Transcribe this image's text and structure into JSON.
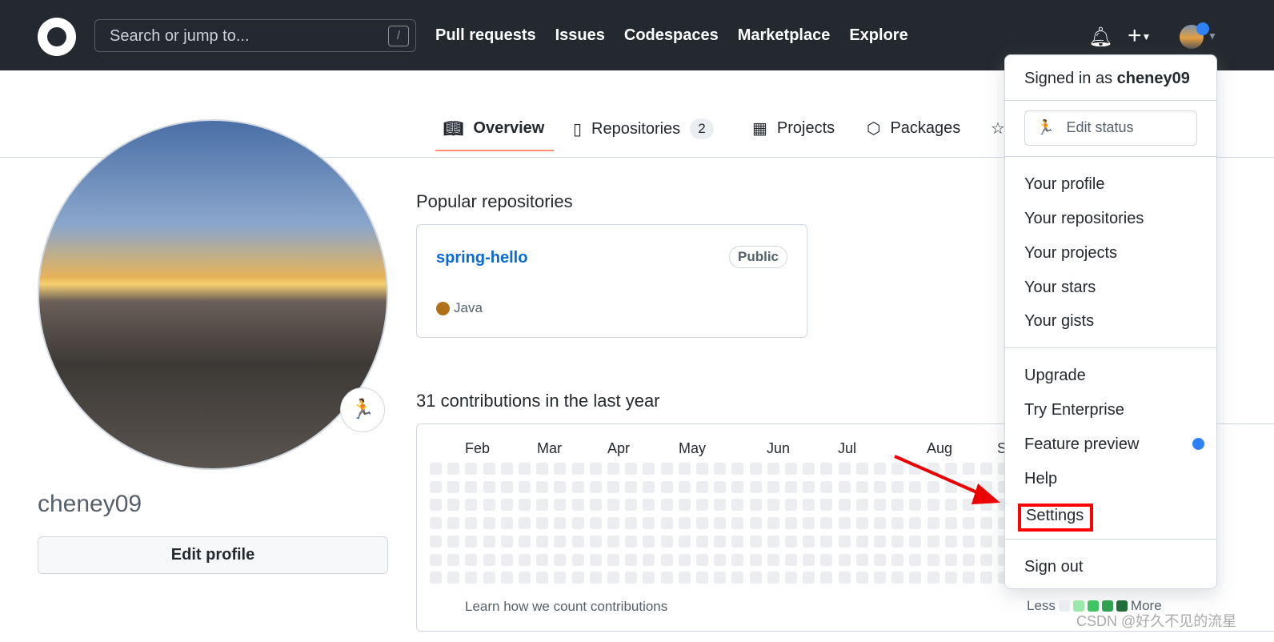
{
  "header": {
    "search_placeholder": "Search or jump to...",
    "slash_key": "/",
    "nav": [
      "Pull requests",
      "Issues",
      "Codespaces",
      "Marketplace",
      "Explore"
    ],
    "notification_dot_color": "#2f81f7"
  },
  "tabs": [
    {
      "label": "Overview",
      "icon": "book-icon"
    },
    {
      "label": "Repositories",
      "icon": "repo-icon",
      "count": "2"
    },
    {
      "label": "Projects",
      "icon": "table-icon"
    },
    {
      "label": "Packages",
      "icon": "package-icon"
    },
    {
      "label": "",
      "icon": "star-icon"
    }
  ],
  "profile": {
    "username": "cheney09",
    "edit_profile": "Edit profile",
    "status_emoji": "🏃"
  },
  "popular": {
    "title": "Popular repositories",
    "repos": [
      {
        "name": "spring-hello",
        "visibility": "Public",
        "language": "Java",
        "language_color": "#b07219"
      }
    ]
  },
  "contributions": {
    "title": "31 contributions in the last year",
    "months": [
      "Feb",
      "Mar",
      "Apr",
      "May",
      "Jun",
      "Jul",
      "Aug",
      "S"
    ],
    "learn": "Learn how we count contributions",
    "less": "Less",
    "more": "More",
    "legend_colors": [
      "#ebedf0",
      "#9be9a8",
      "#40c463",
      "#30a14e",
      "#216e39"
    ]
  },
  "menu": {
    "signed_in_prefix": "Signed in as",
    "signed_in_user": "cheney09",
    "edit_status": "Edit status",
    "group1": [
      "Your profile",
      "Your repositories",
      "Your projects",
      "Your stars",
      "Your gists"
    ],
    "group2": [
      "Upgrade",
      "Try Enterprise",
      "Feature preview",
      "Help",
      "Settings"
    ],
    "sign_out": "Sign out",
    "highlighted": "Settings",
    "highlight_color": "#ff0000"
  },
  "watermark": "CSDN @好久不见的流星"
}
